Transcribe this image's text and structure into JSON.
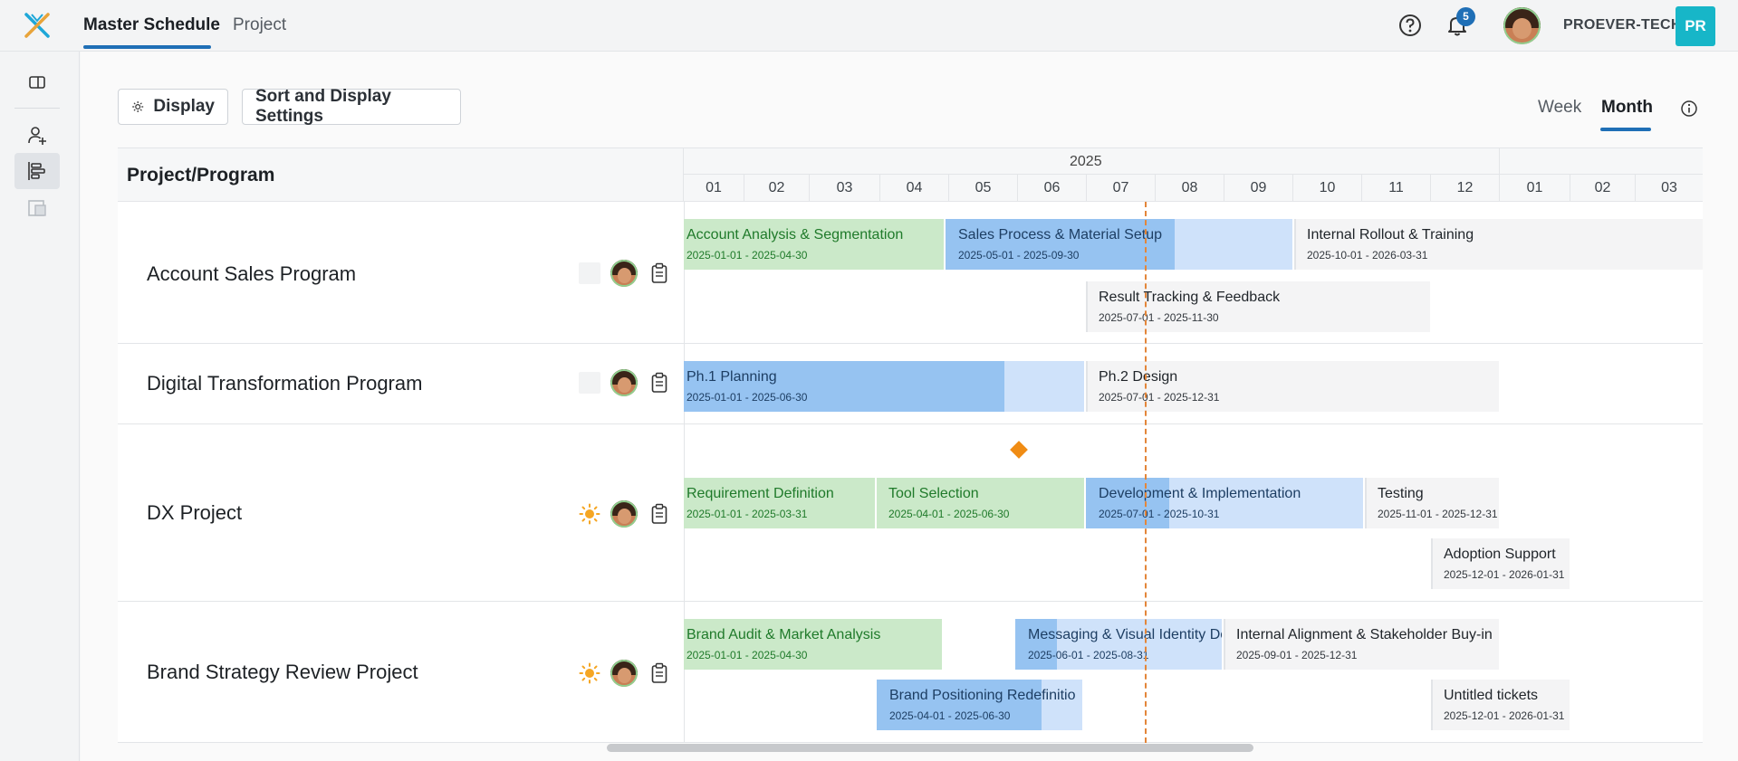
{
  "header": {
    "tabs": [
      {
        "label": "Master Schedule",
        "active": true
      },
      {
        "label": "Project",
        "active": false
      }
    ],
    "notifications_count": "5",
    "org_name": "PROEVER-TECH",
    "org_initials": "PR",
    "icons": [
      "app-logo",
      "help-icon",
      "bell-icon",
      "user-avatar"
    ]
  },
  "rail": {
    "icons": [
      "panel-toggle-icon",
      "add-person-icon",
      "gantt-view-icon",
      "grid-view-icon"
    ],
    "active": "gantt-view-icon"
  },
  "toolbar": {
    "display_label": "Display",
    "sort_label": "Sort and Display Settings",
    "view_week": "Week",
    "view_month": "Month",
    "active_view": "Month"
  },
  "grid": {
    "column_header": "Project/Program",
    "year": "2025",
    "months": [
      "01",
      "02",
      "03",
      "04",
      "05",
      "06",
      "07",
      "08",
      "09",
      "10",
      "11",
      "12",
      "01",
      "02",
      "03"
    ],
    "rows": [
      {
        "name": "Account Sales Program",
        "bars": [
          {
            "title": "Account Analysis & Segmentation",
            "dates": "2025-01-01 - 2025-04-30"
          },
          {
            "title": "Sales Process & Material Setup",
            "dates": "2025-05-01 - 2025-09-30",
            "progress": 0.66
          },
          {
            "title": "Internal Rollout & Training",
            "dates": "2025-10-01 - 2026-03-31"
          },
          {
            "title": "Result Tracking & Feedback",
            "dates": "2025-07-01 - 2025-11-30"
          }
        ]
      },
      {
        "name": "Digital Transformation Program",
        "bars": [
          {
            "title": "Ph.1 Planning",
            "dates": "2025-01-01 - 2025-06-30",
            "progress": 0.8
          },
          {
            "title": "Ph.2 Design",
            "dates": "2025-07-01 - 2025-12-31"
          }
        ]
      },
      {
        "name": "DX Project",
        "bars": [
          {
            "title": "Requirement Definition",
            "dates": "2025-01-01 - 2025-03-31"
          },
          {
            "title": "Tool Selection",
            "dates": "2025-04-01 - 2025-06-30"
          },
          {
            "title": "Development & Implementation",
            "dates": "2025-07-01 - 2025-10-31",
            "progress": 0.3
          },
          {
            "title": "Testing",
            "dates": "2025-11-01 - 2025-12-31"
          },
          {
            "title": "Adoption Support",
            "dates": "2025-12-01 - 2026-01-31"
          }
        ]
      },
      {
        "name": "Brand Strategy Review Project",
        "bars": [
          {
            "title": "Brand Audit & Market Analysis",
            "dates": "2025-01-01 - 2025-04-30"
          },
          {
            "title": "Messaging & Visual Identity De",
            "dates": "2025-06-01 - 2025-08-31",
            "progress": 0.2
          },
          {
            "title": "Internal Alignment & Stakeholder Buy-in",
            "dates": "2025-09-01 - 2025-12-31"
          },
          {
            "title": "Brand Positioning Redefinitio",
            "dates": "2025-04-01 - 2025-06-30",
            "progress": 0.8
          },
          {
            "title": "Untitled tickets",
            "dates": "2025-12-01 - 2026-01-31"
          }
        ]
      }
    ]
  },
  "colors": {
    "accent": "#1f6fb6",
    "org_badge": "#17b6c8",
    "done_green": "#cbe9c9",
    "progress_blue": "#96c3f1",
    "today_line": "#e3863a",
    "milestone": "#f08c14"
  }
}
